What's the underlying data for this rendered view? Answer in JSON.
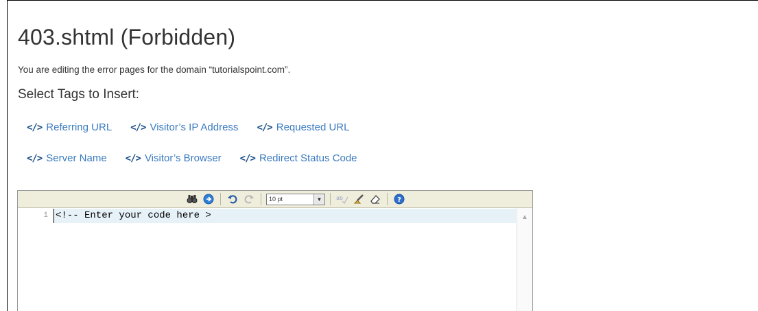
{
  "page": {
    "title": "403.shtml (Forbidden)",
    "description": "You are editing the error pages for the domain “tutorialspoint.com”.",
    "tags_heading": "Select Tags to Insert:"
  },
  "tags": [
    {
      "label": "Referring URL"
    },
    {
      "label": "Visitor’s IP Address"
    },
    {
      "label": "Requested URL"
    },
    {
      "label": "Server Name"
    },
    {
      "label": "Visitor’s Browser"
    },
    {
      "label": "Redirect Status Code"
    }
  ],
  "tag_icon": "</>",
  "editor": {
    "font_size": "10 pt",
    "toolbar_icons": [
      "search-icon",
      "goto-line-icon",
      "undo-icon",
      "redo-icon",
      "font-size-select",
      "spellcheck-icon",
      "highlight-icon",
      "eraser-icon",
      "help-icon"
    ],
    "line_number": "1",
    "code": "<!-- Enter your code here >"
  },
  "colors": {
    "link": "#3b7bbf",
    "toolbar_bg": "#efeedc",
    "active_line": "#e6f1f8"
  }
}
